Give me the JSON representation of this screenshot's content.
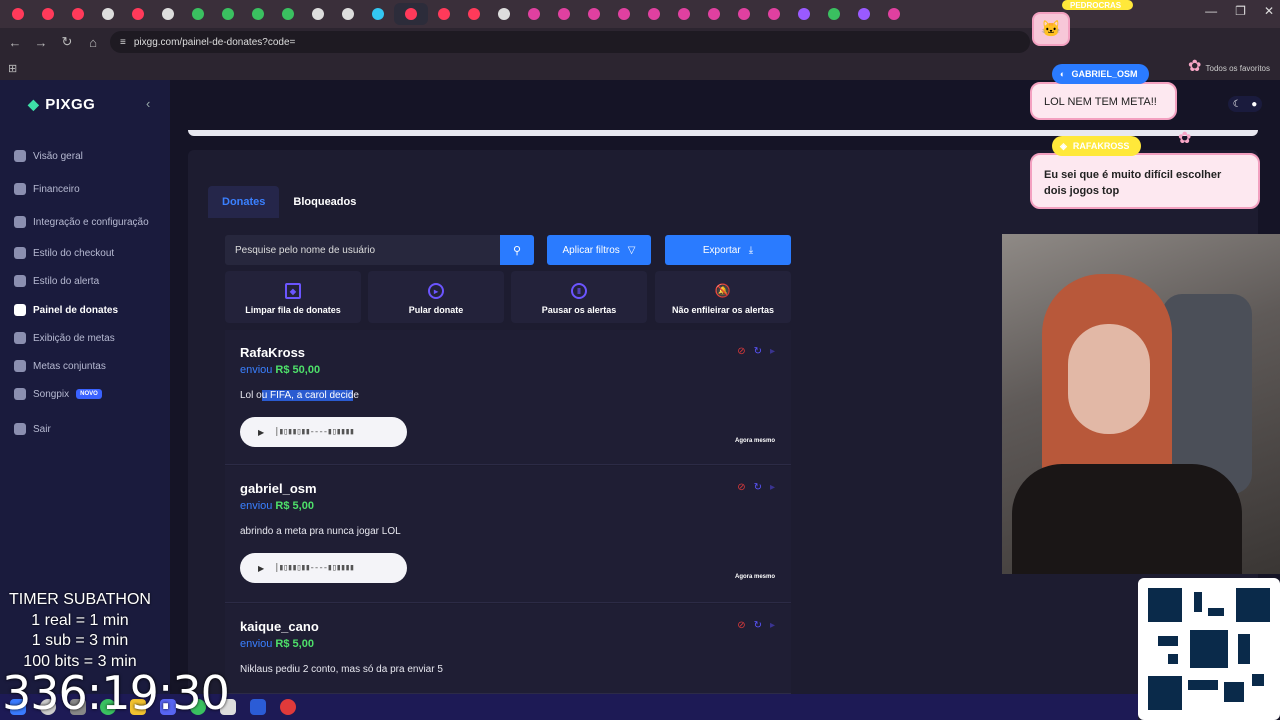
{
  "browser": {
    "url": "pixgg.com/painel-de-donates?code=",
    "favorites_label": "Todos os favoritos",
    "tab_colors": [
      "#ff3a5a",
      "#ff3a5a",
      "#ff3a5a",
      "#ddd",
      "#ff3a5a",
      "#ddd",
      "#3ac060",
      "#3ac060",
      "#3ac060",
      "#3ac060",
      "#ddd",
      "#ddd",
      "#33c7f2",
      "#ff3a5a",
      "#ff3a5a",
      "#ff3a5a",
      "#ddd",
      "#e040a0",
      "#e040a0",
      "#e040a0",
      "#e040a0",
      "#e040a0",
      "#e040a0",
      "#e040a0",
      "#e040a0",
      "#e040a0",
      "#9a5aff",
      "#3ac060",
      "#9a5aff",
      "#e040a0"
    ]
  },
  "app": {
    "logo": "PIXGG",
    "nav": [
      {
        "label": "Visão geral",
        "icon": "home-icon"
      },
      {
        "label": "Financeiro",
        "icon": "wallet-icon"
      },
      {
        "label": "Integração e configuração",
        "icon": "settings-icon"
      },
      {
        "label": "Estilo do checkout",
        "icon": "palette-icon"
      },
      {
        "label": "Estilo do alerta",
        "icon": "bell-icon"
      },
      {
        "label": "Painel de donates",
        "icon": "donate-icon"
      },
      {
        "label": "Exibição de metas",
        "icon": "star-icon"
      },
      {
        "label": "Metas conjuntas",
        "icon": "group-icon"
      },
      {
        "label": "Songpix",
        "icon": "music-icon",
        "badge": "NOVO"
      },
      {
        "label": "Sair",
        "icon": "logout-icon"
      }
    ],
    "tabs": [
      "Donates",
      "Bloqueados"
    ],
    "search_placeholder": "Pesquise pelo nome de usuário",
    "filters_label": "Aplicar filtros",
    "export_label": "Exportar",
    "actions": [
      "Limpar fila de donates",
      "Pular donate",
      "Pausar os alertas",
      "Não enfileirar os alertas"
    ],
    "sent_label": "enviou",
    "donates": [
      {
        "user": "RafaKross",
        "amount": "R$ 50,00",
        "msg_a": "Lol o",
        "msg_b": "u FIFA, a carol decid",
        "msg_c": "e",
        "time": "Agora mesmo"
      },
      {
        "user": "gabriel_osm",
        "amount": "R$ 5,00",
        "msg_a": "abrindo a meta pra nunca jogar LOL",
        "msg_b": "",
        "msg_c": "",
        "time": "Agora mesmo"
      },
      {
        "user": "kaique_cano",
        "amount": "R$ 5,00",
        "msg_a": "Niklaus pediu 2 conto, mas só da pra enviar 5",
        "msg_b": "",
        "msg_c": "",
        "time": ""
      }
    ]
  },
  "overlay": {
    "chat": [
      {
        "name": "GABRIEL_OSM",
        "text": "LOL NEM TEM META!!"
      },
      {
        "name": "RAFAKROSS",
        "text": "Eu sei que é muito difícil escolher dois jogos top"
      }
    ],
    "top_name": "PEDROCRAS",
    "timer": {
      "title": "TIMER SUBATHON",
      "lines": [
        "1 real = 1 min",
        "1 sub = 3 min",
        "100 bits = 3 min"
      ],
      "value": "336:19:30"
    }
  }
}
